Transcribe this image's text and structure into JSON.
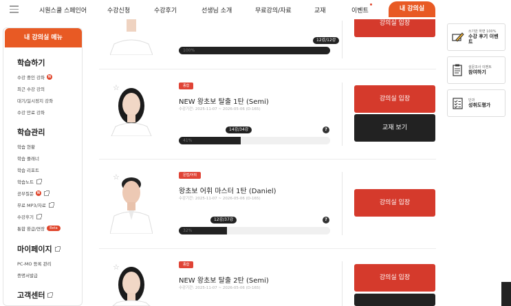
{
  "topnav": {
    "items": [
      {
        "label": "시원스쿨 스페인어"
      },
      {
        "label": "수강신청"
      },
      {
        "label": "수강후기"
      },
      {
        "label": "선생님 소개"
      },
      {
        "label": "무료강의/자료"
      },
      {
        "label": "교재"
      },
      {
        "label": "이벤트"
      }
    ],
    "myroom_label": "내 강의실"
  },
  "sidebar": {
    "header": "내 강의실 메뉴",
    "sections": [
      {
        "title": "학습하기",
        "items": [
          "수강 중인 강좌",
          "최근 수강 강의",
          "대기/일시정지 강좌",
          "수강 만료 강좌"
        ]
      },
      {
        "title": "학습관리",
        "items": [
          "학습 현황",
          "학습 플래너",
          "학습 리포트",
          "학습노트",
          "공부질문",
          "무료 MP3/자료",
          "수강후기",
          "통합 환급/연장"
        ]
      },
      {
        "title": "마이페이지",
        "items": [
          "PC-MO 등록 관리",
          "증명서발급"
        ]
      },
      {
        "title": "고객센터",
        "items": []
      }
    ],
    "badge_n": "N",
    "badge_beta": "Beta"
  },
  "courses": [
    {
      "progress_pct": 100,
      "progress_label": "100%",
      "lessons": "12강/12강",
      "buttons": [
        "강의실 입장"
      ]
    },
    {
      "tag": "종합",
      "title": "NEW 왕초보 탈출 1탄 (Semi)",
      "period": "수강기간: 2025-11-07 ~ 2026-05-06 (D-165)",
      "progress_pct": 41,
      "progress_label": "41%",
      "lessons": "14강/34강",
      "buttons": [
        "강의실 입장",
        "교재 보기"
      ]
    },
    {
      "tag": "문법/어휘",
      "title": "왕초보 어휘 마스터 1탄 (Daniel)",
      "period": "수강기간: 2025-11-07 ~ 2026-05-06 (D-165)",
      "progress_pct": 32,
      "progress_label": "32%",
      "lessons": "12강/37강",
      "buttons": [
        "강의실 입장"
      ]
    },
    {
      "tag": "종합",
      "title": "NEW 왕초보 탈출 2탄 (Semi)",
      "period": "수강기간: 2025-11-07 ~ 2026-05-06 (D-165)",
      "buttons": [
        "강의실 입장"
      ]
    }
  ],
  "right_cards": [
    {
      "small": "쓰기만 하면 100%",
      "big": "수강 후기 이벤트",
      "icon": "pen-icon"
    },
    {
      "small": "설문조사 이벤트",
      "big": "참여하기",
      "icon": "survey-icon"
    },
    {
      "small": "단과",
      "big": "성취도평가",
      "icon": "checklist-icon"
    }
  ],
  "colors": {
    "accent": "#e85a24",
    "button_red": "#d53a2c",
    "dark": "#222222",
    "tag_red": "#e04436"
  }
}
